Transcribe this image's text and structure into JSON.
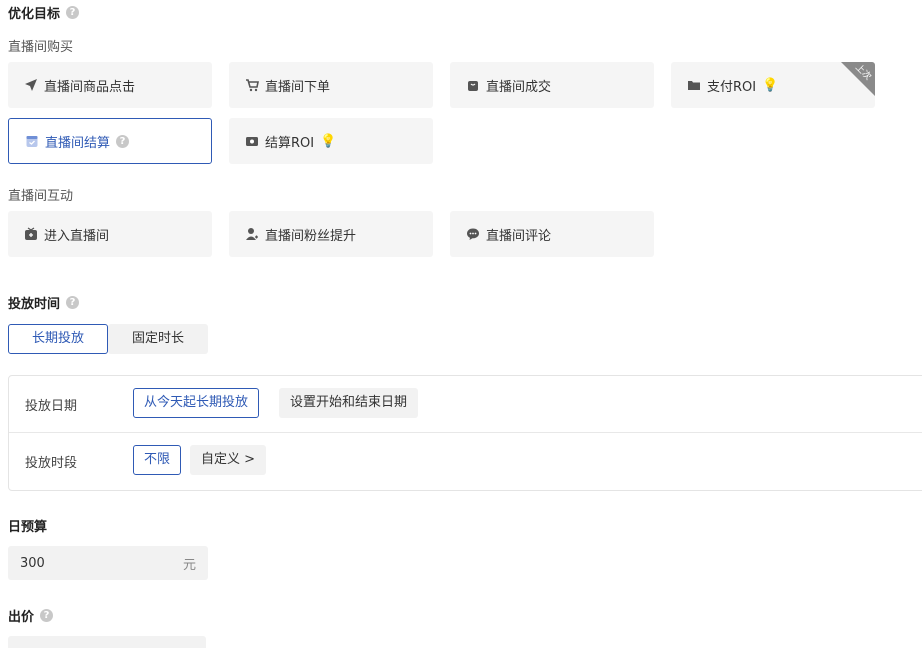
{
  "optimization": {
    "title": "优化目标",
    "help": "?",
    "groups": {
      "purchase": {
        "label": "直播间购买",
        "items": [
          {
            "label": "直播间商品点击",
            "icon": "send-icon"
          },
          {
            "label": "直播间下单",
            "icon": "cart-icon"
          },
          {
            "label": "直播间成交",
            "icon": "bag-icon"
          },
          {
            "label": "支付ROI",
            "icon": "folder-icon",
            "bulb": true,
            "corner": "上次"
          },
          {
            "label": "直播间结算",
            "icon": "calendar-icon",
            "selected": true,
            "help": "?"
          },
          {
            "label": "结算ROI",
            "icon": "wallet-icon",
            "bulb": true
          }
        ]
      },
      "interaction": {
        "label": "直播间互动",
        "items": [
          {
            "label": "进入直播间",
            "icon": "tv-icon"
          },
          {
            "label": "直播间粉丝提升",
            "icon": "user-plus-icon"
          },
          {
            "label": "直播间评论",
            "icon": "chat-icon"
          }
        ]
      }
    }
  },
  "schedule": {
    "title": "投放时间",
    "help": "?",
    "tabs": [
      {
        "label": "长期投放",
        "active": true
      },
      {
        "label": "固定时长",
        "active": false
      }
    ],
    "date_row": {
      "label": "投放日期",
      "options": [
        {
          "label": "从今天起长期投放",
          "active": true
        },
        {
          "label": "设置开始和结束日期",
          "active": false
        }
      ]
    },
    "period_row": {
      "label": "投放时段",
      "options": [
        {
          "label": "不限",
          "active": true
        },
        {
          "label": "自定义 >",
          "active": false
        }
      ]
    }
  },
  "budget": {
    "title": "日预算",
    "value": "300",
    "unit": "元"
  },
  "bid": {
    "title": "出价",
    "help": "?"
  },
  "colors": {
    "accent": "#2f5ab5",
    "card_bg": "#f5f5f5",
    "help_bg": "#c8c8c8"
  }
}
